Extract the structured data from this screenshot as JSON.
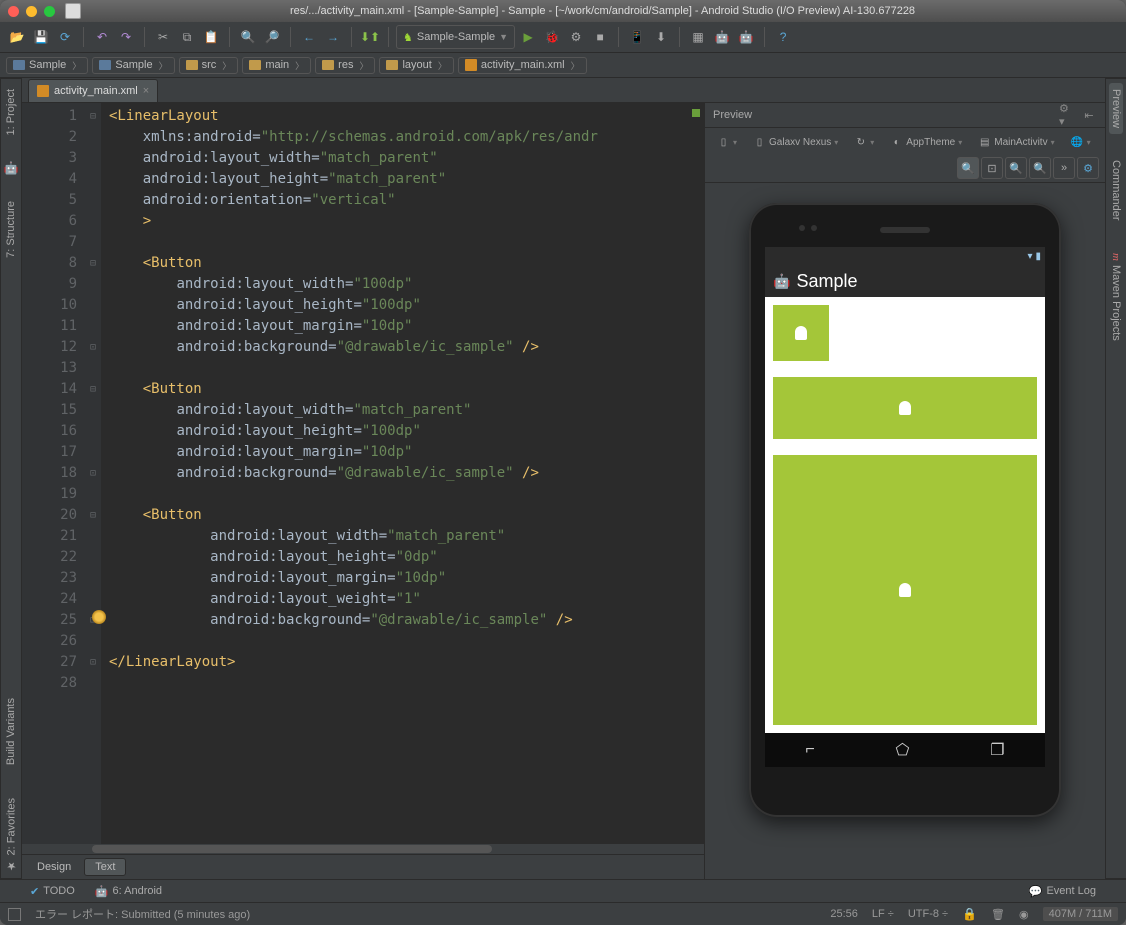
{
  "title": "res/.../activity_main.xml - [Sample-Sample] - Sample - [~/work/cm/android/Sample] - Android Studio (I/O Preview) AI-130.677228",
  "runconfig": "Sample-Sample",
  "breadcrumbs": [
    "Sample",
    "Sample",
    "src",
    "main",
    "res",
    "layout",
    "activity_main.xml"
  ],
  "file_tab": {
    "name": "activity_main.xml"
  },
  "side_left": [
    "1: Project",
    "7: Structure"
  ],
  "side_left_bottom": [
    "Build Variants",
    "2: Favorites"
  ],
  "side_right": [
    "Preview",
    "Commander",
    "Maven Projects"
  ],
  "bottom_tabs": {
    "design": "Design",
    "text": "Text"
  },
  "preview": {
    "title": "Preview",
    "device": "Galaxv Nexus",
    "theme": "AppTheme",
    "activity": "MainActivitv",
    "app_title": "Sample"
  },
  "toolwindows": {
    "todo": "TODO",
    "android": "6: Android",
    "eventlog": "Event Log"
  },
  "status": {
    "msg": "エラー レポート: Submitted (5 minutes ago)",
    "pos": "25:56",
    "linesep": "LF",
    "enc": "UTF-8",
    "mem": "407M / 711M"
  },
  "code_lines": [
    {
      "n": 1,
      "h": "<span class='k-tag'>&lt;LinearLayout</span>"
    },
    {
      "n": 2,
      "h": "    <span class='k-attr'>xmlns:android=</span><span class='k-str'>\"http://schemas.android.com/apk/res/andr</span>"
    },
    {
      "n": 3,
      "h": "    <span class='k-attr'>android:layout_width=</span><span class='k-str'>\"match_parent\"</span>"
    },
    {
      "n": 4,
      "h": "    <span class='k-attr'>android:layout_height=</span><span class='k-str'>\"match_parent\"</span>"
    },
    {
      "n": 5,
      "h": "    <span class='k-attr'>android:orientation=</span><span class='k-str'>\"vertical\"</span>"
    },
    {
      "n": 6,
      "h": "    <span class='k-tag'>&gt;</span>"
    },
    {
      "n": 7,
      "h": ""
    },
    {
      "n": 8,
      "h": "    <span class='k-tag'>&lt;Button</span>"
    },
    {
      "n": 9,
      "h": "        <span class='k-attr'>android:layout_width=</span><span class='k-str'>\"100dp\"</span>"
    },
    {
      "n": 10,
      "h": "        <span class='k-attr'>android:layout_height=</span><span class='k-str'>\"100dp\"</span>"
    },
    {
      "n": 11,
      "h": "        <span class='k-attr'>android:layout_margin=</span><span class='k-str'>\"10dp\"</span>"
    },
    {
      "n": 12,
      "h": "        <span class='k-attr'>android:background=</span><span class='k-str'>\"@drawable/ic_sample\"</span> <span class='k-tag'>/&gt;</span>"
    },
    {
      "n": 13,
      "h": ""
    },
    {
      "n": 14,
      "h": "    <span class='k-tag'>&lt;Button</span>"
    },
    {
      "n": 15,
      "h": "        <span class='k-attr'>android:layout_width=</span><span class='k-str'>\"match_parent\"</span>"
    },
    {
      "n": 16,
      "h": "        <span class='k-attr'>android:layout_height=</span><span class='k-str'>\"100dp\"</span>"
    },
    {
      "n": 17,
      "h": "        <span class='k-attr'>android:layout_margin=</span><span class='k-str'>\"10dp\"</span>"
    },
    {
      "n": 18,
      "h": "        <span class='k-attr'>android:background=</span><span class='k-str'>\"@drawable/ic_sample\"</span> <span class='k-tag'>/&gt;</span>"
    },
    {
      "n": 19,
      "h": ""
    },
    {
      "n": 20,
      "h": "    <span class='k-tag'>&lt;Button</span>"
    },
    {
      "n": 21,
      "h": "            <span class='k-attr'>android:layout_width=</span><span class='k-str'>\"match_parent\"</span>"
    },
    {
      "n": 22,
      "h": "            <span class='k-attr'>android:layout_height=</span><span class='k-str'>\"0dp\"</span>"
    },
    {
      "n": 23,
      "h": "            <span class='k-attr'>android:layout_margin=</span><span class='k-str'>\"10dp\"</span>"
    },
    {
      "n": 24,
      "h": "            <span class='k-attr'>android:layout_weight=</span><span class='k-str'>\"1\"</span>"
    },
    {
      "n": 25,
      "h": "            <span class='k-attr'>android:background=</span><span class='k-str'>\"@drawable/ic_sample\"</span> <span class='k-tag'>/&gt;</span>"
    },
    {
      "n": 26,
      "h": ""
    },
    {
      "n": 27,
      "h": "<span class='k-tag'>&lt;/LinearLayout&gt;</span>"
    },
    {
      "n": 28,
      "h": ""
    }
  ],
  "folds": {
    "1": "⊟",
    "8": "⊟",
    "12": "⊡",
    "14": "⊟",
    "18": "⊡",
    "20": "⊟",
    "25": "⊡",
    "27": "⊡"
  }
}
